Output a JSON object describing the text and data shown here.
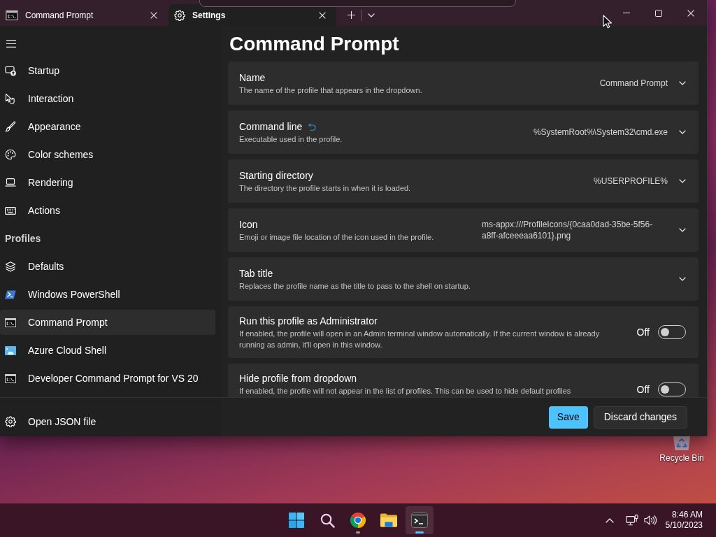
{
  "title_bar": {
    "tabs": [
      {
        "label": "Command Prompt",
        "selected": false
      },
      {
        "label": "Settings",
        "selected": true
      }
    ]
  },
  "sidebar": {
    "items": [
      {
        "label": "Startup",
        "selected": false
      },
      {
        "label": "Interaction",
        "selected": false
      },
      {
        "label": "Appearance",
        "selected": false
      },
      {
        "label": "Color schemes",
        "selected": false
      },
      {
        "label": "Rendering",
        "selected": false
      },
      {
        "label": "Actions",
        "selected": false
      }
    ],
    "profiles_header": "Profiles",
    "profiles": [
      {
        "label": "Defaults",
        "selected": false
      },
      {
        "label": "Windows PowerShell",
        "selected": false
      },
      {
        "label": "Command Prompt",
        "selected": true
      },
      {
        "label": "Azure Cloud Shell",
        "selected": false
      },
      {
        "label": "Developer Command Prompt for VS 20",
        "selected": false
      }
    ],
    "footer_item": "Open JSON file"
  },
  "page": {
    "title": "Command Prompt",
    "settings": [
      {
        "kind": "dropdown",
        "title": "Name",
        "description": "The name of the profile that appears in the dropdown.",
        "value": "Command Prompt",
        "modified": false
      },
      {
        "kind": "dropdown",
        "title": "Command line",
        "description": "Executable used in the profile.",
        "value": "%SystemRoot%\\System32\\cmd.exe",
        "modified": true
      },
      {
        "kind": "dropdown",
        "title": "Starting directory",
        "description": "The directory the profile starts in when it is loaded.",
        "value": "%USERPROFILE%",
        "modified": false
      },
      {
        "kind": "dropdown",
        "title": "Icon",
        "description": "Emoji or image file location of the icon used in the profile.",
        "value": "ms-appx:///ProfileIcons/{0caa0dad-35be-5f56-a8ff-afceeeaa6101}.png",
        "modified": false
      },
      {
        "kind": "dropdown",
        "title": "Tab title",
        "description": "Replaces the profile name as the title to pass to the shell on startup.",
        "modified": false
      },
      {
        "kind": "toggle",
        "title": "Run this profile as Administrator",
        "description": "If enabled, the profile will open in an Admin terminal window automatically. If the current window is already running as admin, it'll open in this window.",
        "state_label": "Off",
        "on": false,
        "modified": false
      },
      {
        "kind": "toggle",
        "title": "Hide profile from dropdown",
        "description": "If enabled, the profile will not appear in the list of profiles. This can be used to hide default profiles",
        "state_label": "Off",
        "on": false,
        "modified": false
      }
    ]
  },
  "footer": {
    "buttons": [
      {
        "label": "Save",
        "kind": "primary"
      },
      {
        "label": "Discard changes",
        "kind": "secondary"
      }
    ]
  },
  "desktop": {
    "icons": [
      {
        "label": "Recycle Bin"
      }
    ]
  },
  "taskbar": {
    "apps": [
      {
        "active": false,
        "running": false
      },
      {
        "active": false,
        "running": false
      },
      {
        "active": false,
        "running": true
      },
      {
        "active": false,
        "running": false
      },
      {
        "active": true,
        "running": true
      }
    ],
    "clock": {
      "time": "8:46 AM",
      "date": "5/10/2023"
    }
  }
}
